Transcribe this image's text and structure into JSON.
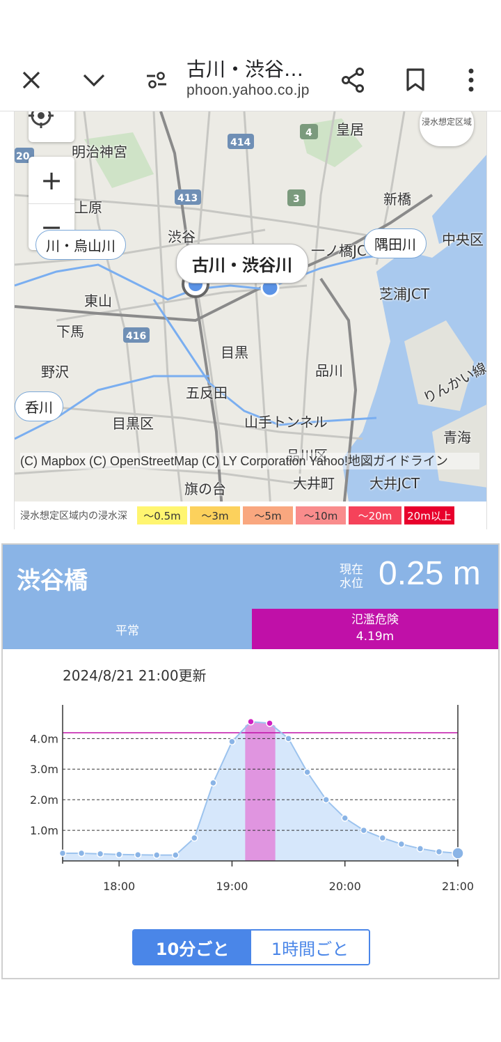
{
  "browser": {
    "title": "古川・渋谷…",
    "url": "phoon.yahoo.co.jp"
  },
  "map": {
    "labels": {
      "meiji": "明治神宮",
      "uehara": "上原",
      "kokyo": "皇居",
      "shinbashi": "新橋",
      "chuoku": "中央区",
      "shibuya": "渋谷",
      "higashiyama": "東山",
      "shimouma": "下馬",
      "nozawa": "野沢",
      "meguro": "目黒",
      "shinagawa": "品川",
      "gotanda": "五反田",
      "shibaura": "芝浦JCT",
      "meguroku": "目黒区",
      "yamate": "山手トンネル",
      "shinagawaku": "品川区",
      "aomi": "青海",
      "rinkai": "りんかい線",
      "hatanodai": "旗の台",
      "oimachi": "大井町",
      "oijct": "大井JCT",
      "ichinohashi": "一ノ橋JC"
    },
    "route_numbers": [
      "4",
      "414",
      "413",
      "3",
      "416",
      "20"
    ],
    "bubbles": {
      "furukawa": "古川・渋谷川",
      "karasuyama": "川・烏山川",
      "sumida": "隅田川",
      "nomigawa": "呑川"
    },
    "flood_button": "浸水想定区域",
    "zoom_in": "+",
    "zoom_out": "−",
    "credit": "(C) Mapbox (C) OpenStreetMap (C) LY Corporation Yahoo!地図ガイドライン",
    "legend": {
      "title": "浸水想定区域内の浸水深",
      "items": [
        {
          "label": "～0.5m",
          "color": "#fff570"
        },
        {
          "label": "～3m",
          "color": "#fcd15c"
        },
        {
          "label": "～5m",
          "color": "#f9a77f"
        },
        {
          "label": "～10m",
          "color": "#f98c8c"
        },
        {
          "label": "～20m",
          "color": "#f5425a"
        },
        {
          "label": "20m以上",
          "color": "#e8002c"
        }
      ]
    }
  },
  "panel": {
    "station": "渋谷橋",
    "current_label": "現在水位",
    "current_value": "0.25 m",
    "level_normal": "平常",
    "level_danger_label": "氾濫危険",
    "level_danger_value": "4.19m",
    "updated": "2024/8/21 21:00更新",
    "tabs": {
      "ten_min": "10分ごと",
      "hourly": "1時間ごと"
    },
    "colors": {
      "header": "#8ab4e6",
      "danger": "#c010a8",
      "accent": "#4a86e8"
    }
  },
  "chart_data": {
    "type": "area",
    "title": "",
    "xlabel": "",
    "ylabel": "",
    "x_ticks": [
      "18:00",
      "19:00",
      "20:00",
      "21:00"
    ],
    "y_ticks": [
      "1.0m",
      "2.0m",
      "3.0m",
      "4.0m"
    ],
    "xlim": [
      "17:30",
      "21:00"
    ],
    "ylim": [
      0,
      5.1
    ],
    "threshold": 4.19,
    "grid": "dashed horizontal",
    "x": [
      "17:30",
      "17:40",
      "17:50",
      "18:00",
      "18:10",
      "18:20",
      "18:30",
      "18:40",
      "18:50",
      "19:00",
      "19:10",
      "19:20",
      "19:30",
      "19:40",
      "19:50",
      "20:00",
      "20:10",
      "20:20",
      "20:30",
      "20:40",
      "20:50",
      "21:00"
    ],
    "values": [
      0.25,
      0.25,
      0.23,
      0.21,
      0.2,
      0.19,
      0.19,
      0.75,
      2.55,
      3.9,
      4.55,
      4.5,
      4.0,
      2.9,
      2.0,
      1.4,
      1.0,
      0.75,
      0.55,
      0.4,
      0.3,
      0.25
    ]
  }
}
